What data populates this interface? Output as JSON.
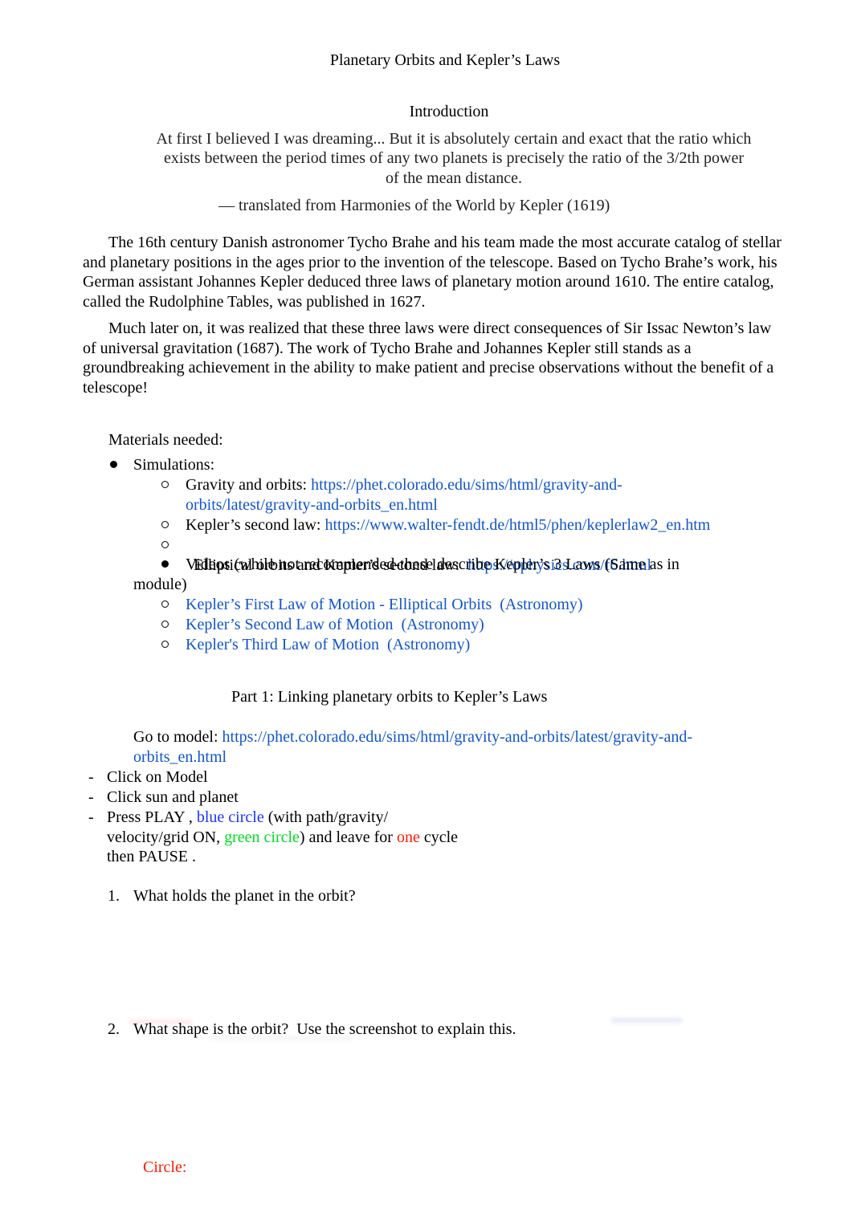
{
  "document": {
    "title": "Planetary Orbits and Kepler’s Laws",
    "intro_heading": "Introduction",
    "quote": {
      "line1": "At first I believed I was dreaming... But it is absolutely certain and exact that the ratio which",
      "line2": "exists between the period times of any two planets is precisely the ratio of the 3/2th power",
      "line3": "of the mean distance.",
      "attribution": "— translated from Harmonies of the World by Kepler (1619)"
    },
    "paragraphs": [
      "The 16th century Danish astronomer Tycho Brahe and his team made the most accurate catalog of stellar and planetary positions in the ages prior to the invention of the telescope. Based on Tycho Brahe’s work, his German assistant Johannes Kepler deduced three laws of planetary motion around 1610. The entire catalog, called the Rudolphine Tables, was published in 1627.",
      "Much later on, it was realized that these three laws were direct consequences of Sir Issac Newton’s law of universal gravitation (1687). The work of Tycho Brahe and Johannes Kepler still stands as a groundbreaking achievement in the ability to make patient and precise observations without the benefit of a telescope!"
    ],
    "materials": {
      "heading": "Materials needed:",
      "simulations_label": "Simulations:",
      "simulations": [
        {
          "label": "Gravity and orbits: ",
          "link_line1": "https://phet.colorado.edu/sims/html/gravity-and-",
          "link_line2": "orbits/latest/gravity-and-orbits_en.html"
        },
        {
          "label": "Kepler’s second law: ",
          "link": "https://www.walter-fendt.de/html5/phen/keplerlaw2_en.htm"
        },
        {
          "label": "Elliptical orbits and Kepler’s second law:  ",
          "link": "https://ophysics.com/f6.html"
        }
      ],
      "videos_label_line1": "Videos (while not recommended-these describe Kepler’s 3 Laws (Same as in",
      "videos_label_line2": "module)",
      "videos": [
        "Kepler’s First Law of Motion - Elliptical Orbits  (Astronomy)",
        "Kepler’s Second Law of Motion  (Astronomy)",
        "Kepler's Third Law of Motion  (Astronomy)"
      ]
    },
    "part1": {
      "heading": "Part 1: Linking planetary orbits to Kepler’s Laws",
      "goto_label": "Go to model: ",
      "goto_link_line1": "https://phet.colorado.edu/sims/html/gravity-and-orbits/latest/gravity-and-",
      "goto_link_line2": "orbits_en.html",
      "steps": {
        "dash": "-",
        "step1": "Click on Model",
        "step2": "Click sun and planet",
        "step3_a": "Press PLAY , ",
        "step3_blue": "blue circle",
        "step3_b": " (with path/gravity/",
        "step3_c": "velocity/grid ON, ",
        "step3_green": "green circle",
        "step3_d": ") and leave for ",
        "step3_red": "one",
        "step3_e": " cycle",
        "step3_f": "then PAUSE ."
      },
      "questions": [
        {
          "number": "1.",
          "text": "What holds the planet in the orbit?"
        },
        {
          "number": "2.",
          "text": "What shape is the orbit?  Use the screenshot to explain this."
        }
      ],
      "answer_label": "Circle:"
    }
  },
  "colors": {
    "link": "#1155cc",
    "blue_text": "#1a33ff",
    "green_text": "#00dd22",
    "red_text": "#ff1a00",
    "quote_text": "#222222"
  }
}
